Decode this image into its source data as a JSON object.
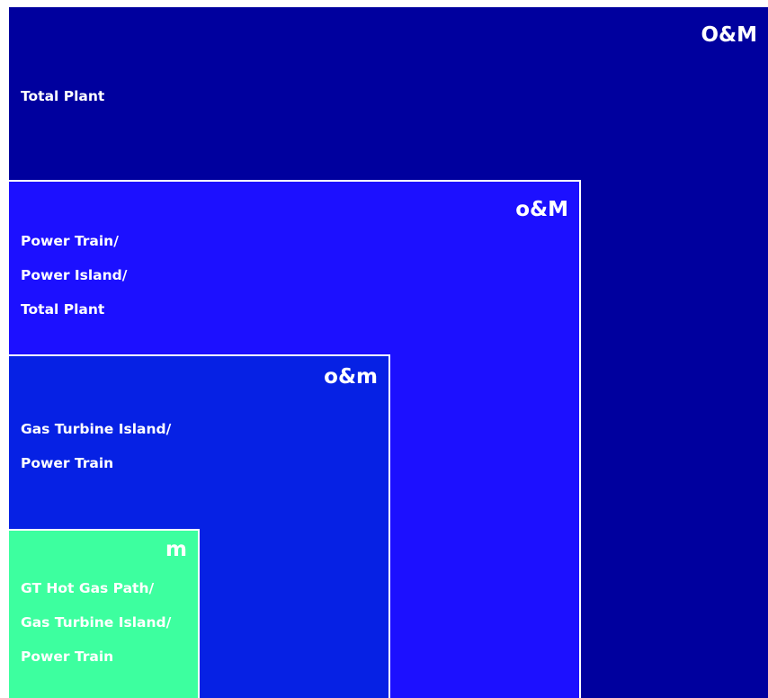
{
  "colors": {
    "total_plant": "#00009e",
    "power_train": "#1c10ff",
    "gas_turbine_island": "#0621e4",
    "gt_hot_gas_path": "#3dff9f",
    "text": "#ffffff",
    "divider": "#ffffff"
  },
  "levels": [
    {
      "tag": "O&M",
      "lines": [
        "Total Plant"
      ]
    },
    {
      "tag": "o&M",
      "lines": [
        "Power Train/",
        "Power Island/",
        "Total Plant"
      ]
    },
    {
      "tag": "o&m",
      "lines": [
        "Gas Turbine Island/",
        "Power Train"
      ]
    },
    {
      "tag": "m",
      "lines": [
        "GT Hot Gas Path/",
        "Gas Turbine Island/",
        "Power Train"
      ]
    }
  ]
}
